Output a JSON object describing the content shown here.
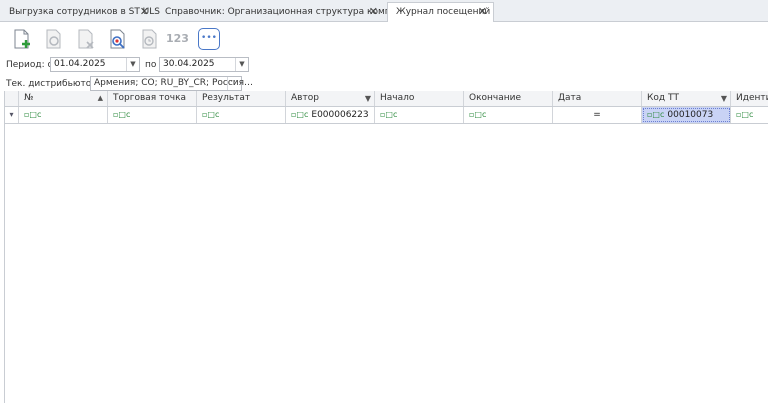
{
  "tabs": [
    {
      "label": "Выгрузка сотрудников в ST ULS",
      "active": false
    },
    {
      "label": "Справочник: Организационная структура компании",
      "active": false
    },
    {
      "label": "Журнал посещений",
      "active": true
    }
  ],
  "toolbar": {
    "buttons": [
      "new-doc-icon",
      "view-doc-icon",
      "delete-doc-icon",
      "find-doc-icon",
      "history-icon",
      "numbering-icon",
      "more-icon"
    ],
    "numbering_label": "123",
    "more_label": "•••"
  },
  "filters": {
    "period_label": "Период: с",
    "date_from": "01.04.2025",
    "to_label": "по",
    "date_to": "30.04.2025",
    "distributor_label": "Тек. дистрибьютор:",
    "distributor_value": "Армения; CO; RU_BY_CR; Россия…",
    "ellipsis": "···"
  },
  "grid": {
    "columns": [
      "№",
      "Торговая точка",
      "Результат",
      "Автор",
      "Начало",
      "Окончание",
      "Дата",
      "Код ТТ",
      "Идентиф"
    ],
    "filter_row": {
      "op_symbol": "▫□c",
      "row_marker": "▾",
      "author": "E000006223",
      "date_op": "=",
      "code_tt": "00010073"
    }
  },
  "colors": {
    "accent": "#4a78c8",
    "selection": "#c9d3f5",
    "op_green": "#2e8b3f"
  }
}
